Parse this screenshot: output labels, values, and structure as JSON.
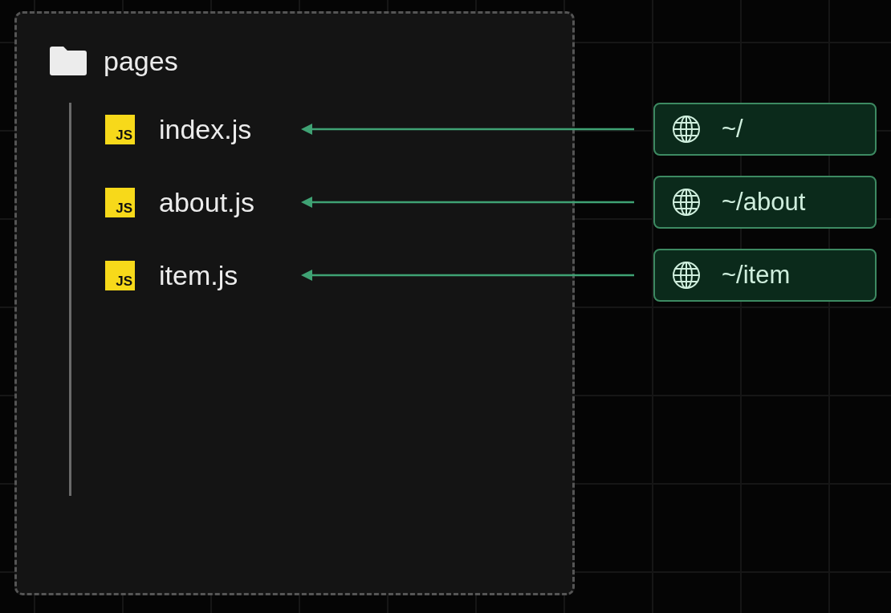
{
  "folder": {
    "name": "pages"
  },
  "rows": [
    {
      "badge": "JS",
      "file": "index.js",
      "route": "~/"
    },
    {
      "badge": "JS",
      "file": "about.js",
      "route": "~/about"
    },
    {
      "badge": "JS",
      "file": "item.js",
      "route": "~/item"
    }
  ]
}
